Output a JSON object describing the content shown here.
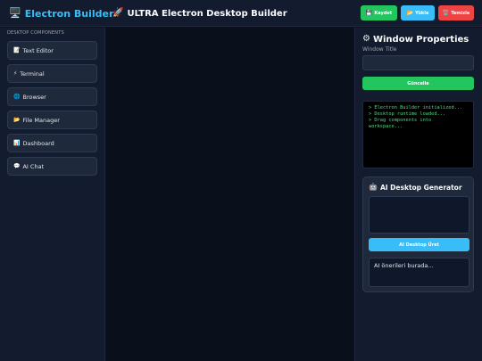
{
  "header": {
    "logo_icon": "🖥️",
    "logo_text": "Electron Builder",
    "title_icon": "🚀",
    "title_text": "ULTRA Electron Desktop Builder",
    "buttons": {
      "save": {
        "icon": "💾",
        "label": "Kaydet"
      },
      "load": {
        "icon": "📂",
        "label": "Yükle"
      },
      "clear": {
        "icon": "🗑️",
        "label": "Temizle"
      }
    }
  },
  "sidebar": {
    "heading": "DESKTOP COMPONENTS",
    "items": [
      {
        "icon": "📝",
        "label": "Text Editor"
      },
      {
        "icon": "⚡",
        "label": "Terminal"
      },
      {
        "icon": "🌐",
        "label": "Browser"
      },
      {
        "icon": "📂",
        "label": "File Manager"
      },
      {
        "icon": "📊",
        "label": "Dashboard"
      },
      {
        "icon": "💬",
        "label": "AI Chat"
      }
    ]
  },
  "properties": {
    "icon": "⚙",
    "title": "Window Properties",
    "window_title_label": "Window Title",
    "window_title_value": "",
    "update_label": "Güncelle"
  },
  "console": {
    "lines": [
      "> Electron Builder initialized...",
      "> Desktop runtime loaded...",
      "> Drag components into",
      "workspace..."
    ]
  },
  "ai": {
    "icon": "🤖",
    "title": "AI Desktop Generator",
    "prompt_value": "",
    "generate_label": "AI Desktop Üret",
    "output_text": "AI önerileri burada..."
  },
  "colors": {
    "accent_blue": "#38bdf8",
    "accent_green": "#22c55e",
    "accent_red": "#ef4444",
    "console_green": "#4ade80",
    "background": "#0b1120",
    "panel": "#131c2e"
  }
}
